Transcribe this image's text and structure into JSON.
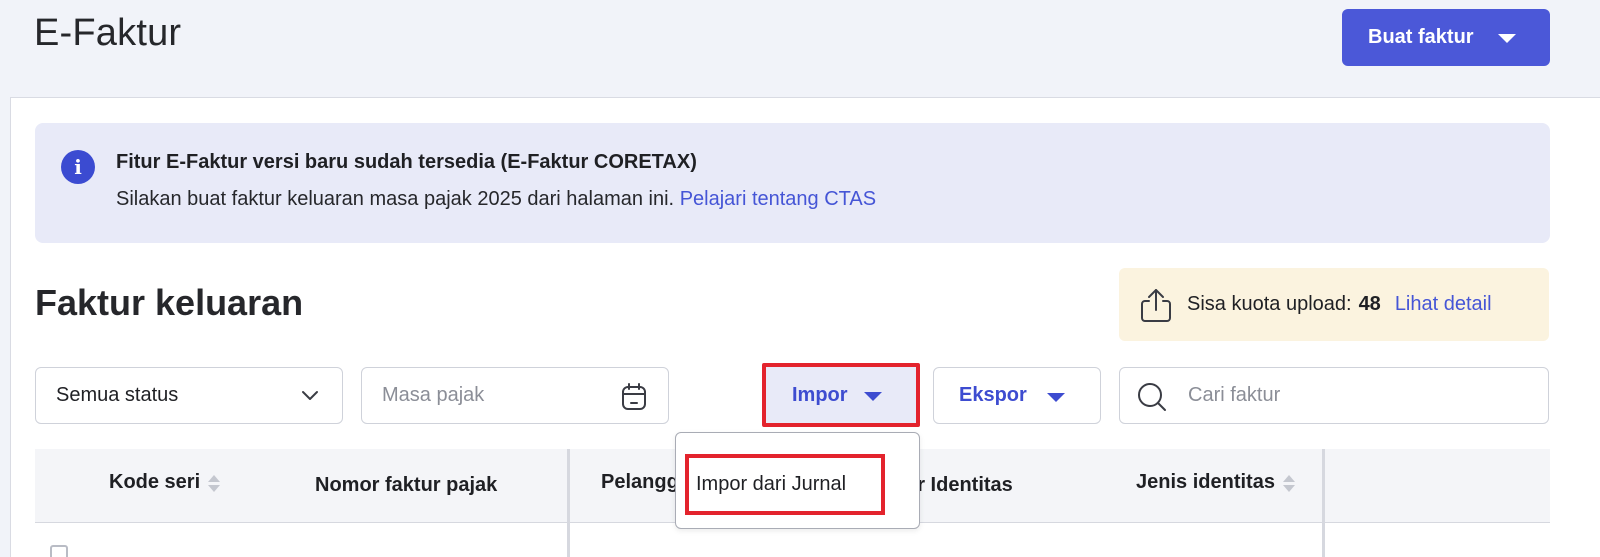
{
  "header": {
    "title": "E-Faktur",
    "create_button": "Buat faktur"
  },
  "info_banner": {
    "title": "Fitur E-Faktur versi baru sudah tersedia (E-Faktur CORETAX)",
    "body": "Silakan buat faktur keluaran masa pajak 2025 dari halaman ini.",
    "link": "Pelajari tentang CTAS",
    "icon": "info-icon"
  },
  "section": {
    "title": "Faktur keluaran"
  },
  "quota": {
    "label": "Sisa kuota upload:",
    "value": "48",
    "link": "Lihat detail",
    "icon": "upload-icon"
  },
  "filters": {
    "status_value": "Semua status",
    "period_placeholder": "Masa pajak",
    "import_label": "Impor",
    "export_label": "Ekspor",
    "search_placeholder": "Cari faktur"
  },
  "import_menu": {
    "items": [
      {
        "label": "Impor dari Jurnal"
      }
    ]
  },
  "table": {
    "columns": [
      {
        "label": "Kode seri",
        "sortable": true
      },
      {
        "label": "Nomor faktur pajak",
        "sortable": false
      },
      {
        "label": "Pelangg",
        "sortable": false
      },
      {
        "label": "or Identitas",
        "sortable": false
      },
      {
        "label": "Jenis identitas",
        "sortable": true
      }
    ]
  },
  "colors": {
    "primary": "#4b58d8",
    "link": "#4555d6",
    "highlight": "#e3232d",
    "info_bg": "#e8eaf8",
    "quota_bg": "#fbf3df"
  }
}
